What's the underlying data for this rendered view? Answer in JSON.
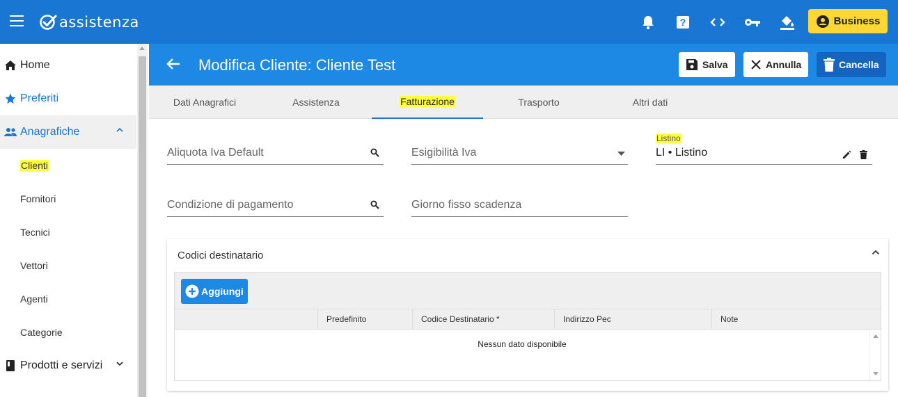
{
  "app": {
    "logo_text": "assistenza",
    "business_label": "Business"
  },
  "sidebar": {
    "items": [
      {
        "label": "Home",
        "icon": "home-icon"
      },
      {
        "label": "Preferiti",
        "icon": "star-icon"
      },
      {
        "label": "Anagrafiche",
        "icon": "people-icon"
      },
      {
        "label": "Clienti"
      },
      {
        "label": "Fornitori"
      },
      {
        "label": "Tecnici"
      },
      {
        "label": "Vettori"
      },
      {
        "label": "Agenti"
      },
      {
        "label": "Categorie"
      },
      {
        "label": "Prodotti e servizi",
        "icon": "book-icon"
      }
    ]
  },
  "page": {
    "title": "Modifica Cliente: Cliente Test",
    "save_label": "Salva",
    "cancel_label": "Annulla",
    "delete_label": "Cancella"
  },
  "tabs": [
    {
      "label": "Dati Anagrafici"
    },
    {
      "label": "Assistenza"
    },
    {
      "label": "Fatturazione"
    },
    {
      "label": "Trasporto"
    },
    {
      "label": "Altri dati"
    }
  ],
  "form": {
    "aliquota_placeholder": "Aliquota Iva Default",
    "esigibilita_placeholder": "Esigibilità Iva",
    "listino_label": "Listino",
    "listino_value": "LI • Listino",
    "condizione_placeholder": "Condizione di pagamento",
    "giorno_placeholder": "Giorno fisso scadenza"
  },
  "codici": {
    "title": "Codici destinatario",
    "add_label": "Aggiungi",
    "columns": [
      "Predefinito",
      "Codice Destinatario *",
      "Indirizzo Pec",
      "Note"
    ],
    "empty_text": "Nessun dato disponibile"
  },
  "colors": {
    "primary": "#1976d2",
    "header": "#1e88e5",
    "accent": "#fdd835",
    "highlight": "#ffff40"
  }
}
